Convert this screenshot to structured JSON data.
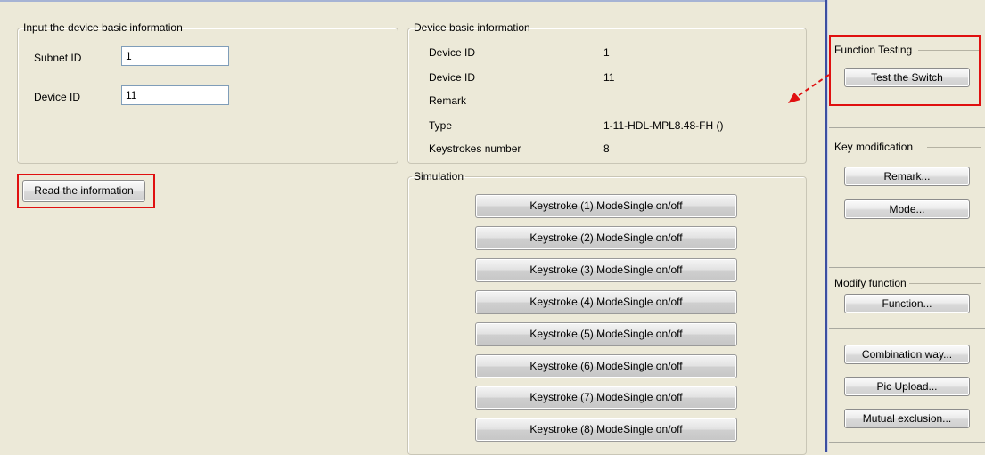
{
  "input_group": {
    "legend": "Input the device basic information",
    "subnet_label": "Subnet ID",
    "subnet_value": "1",
    "device_label": "Device ID",
    "device_value": "11"
  },
  "read_button": "Read the information",
  "info_group": {
    "legend": "Device basic information",
    "rows": [
      {
        "label": "Device ID",
        "value": "1"
      },
      {
        "label": "Device ID",
        "value": "11"
      },
      {
        "label": "Remark",
        "value": ""
      },
      {
        "label": "Type",
        "value": "1-11-HDL-MPL8.48-FH ()"
      },
      {
        "label": "Keystrokes number",
        "value": "8"
      }
    ]
  },
  "simulation": {
    "legend": "Simulation",
    "keys": [
      "Keystroke (1) ModeSingle on/off",
      "Keystroke (2) ModeSingle on/off",
      "Keystroke (3) ModeSingle on/off",
      "Keystroke (4) ModeSingle on/off",
      "Keystroke (5) ModeSingle on/off",
      "Keystroke (6) ModeSingle on/off",
      "Keystroke (7) ModeSingle on/off",
      "Keystroke (8) ModeSingle on/off"
    ]
  },
  "right_panel": {
    "function_testing": {
      "legend": "Function Testing",
      "test_button": "Test the Switch"
    },
    "key_modification": {
      "legend": "Key modification",
      "remark_button": "Remark...",
      "mode_button": "Mode..."
    },
    "modify_function": {
      "legend": "Modify function",
      "function_button": "Function..."
    },
    "extra": {
      "combination_button": "Combination way...",
      "pic_upload_button": "Pic Upload...",
      "mutual_exclusion_button": "Mutual exclusion..."
    }
  },
  "colors": {
    "highlight": "#e01010",
    "background": "#ece9d8",
    "separator": "#3c4fa0"
  }
}
